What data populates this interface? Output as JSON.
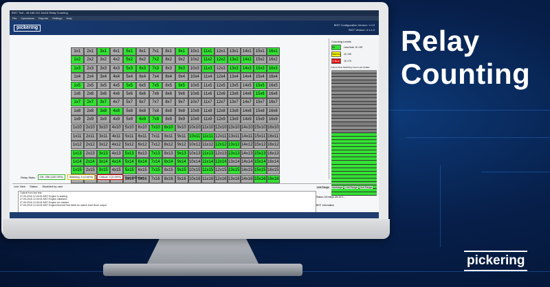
{
  "headline": "Relay Counting",
  "brand": "pickering",
  "app": {
    "title": "BIST Tool - 40-160-101 16x16 Relay Counting",
    "menu": [
      "File",
      "Operations",
      "Reports",
      "Settings",
      "Help"
    ],
    "logo": "pickering",
    "config_line1": "BIST Configuration Version: 1.0.3",
    "config_line2": "BIST Version: 4.1.4.3"
  },
  "colors": {
    "green": "#33e233",
    "gray": "#a9a9a9",
    "yellow": "#ffff00",
    "red": "#e00000"
  },
  "grid": {
    "rows": [
      [
        "1x1",
        "2x1",
        "3x1",
        "4x1",
        "5x1",
        "6x1",
        "7x1",
        "8x1",
        "9x1",
        "10x1",
        "11x1",
        "12x1",
        "13x1",
        "14x1",
        "15x1",
        "16x1"
      ],
      [
        "1x2",
        "2x2",
        "3x2",
        "4x2",
        "5x2",
        "6x2",
        "7x2",
        "8x2",
        "9x2",
        "10x2",
        "11x2",
        "12x2",
        "13x2",
        "14x2",
        "15x2",
        "16x2"
      ],
      [
        "1x3",
        "2x3",
        "3x3",
        "4x3",
        "5x3",
        "6x3",
        "7x3",
        "8x3",
        "9x3",
        "10x3",
        "11x3",
        "12x3",
        "13x3",
        "14x3",
        "15x3",
        "16x3"
      ],
      [
        "1x4",
        "2x4",
        "3x4",
        "4x4",
        "5x4",
        "6x4",
        "7x4",
        "8x4",
        "9x4",
        "10x4",
        "11x4",
        "12x4",
        "13x4",
        "14x4",
        "15x4",
        "16x4"
      ],
      [
        "1x5",
        "2x5",
        "3x5",
        "4x5",
        "5x5",
        "6x5",
        "7x5",
        "8x5",
        "9x5",
        "10x5",
        "11x5",
        "12x5",
        "13x5",
        "14x5",
        "15x5",
        "16x5"
      ],
      [
        "1x6",
        "2x6",
        "3x6",
        "4x6",
        "5x6",
        "6x6",
        "7x6",
        "8x6",
        "9x6",
        "10x6",
        "11x6",
        "12x6",
        "13x6",
        "14x6",
        "15x6",
        "16x6"
      ],
      [
        "1x7",
        "2x7",
        "3x7",
        "4x7",
        "5x7",
        "6x7",
        "7x7",
        "8x7",
        "9x7",
        "10x7",
        "11x7",
        "12x7",
        "13x7",
        "14x7",
        "15x7",
        "16x7"
      ],
      [
        "1x8",
        "2x8",
        "3x8",
        "4x8",
        "5x8",
        "6x8",
        "7x8",
        "8x8",
        "9x8",
        "10x8",
        "11x8",
        "12x8",
        "13x8",
        "14x8",
        "15x8",
        "16x8"
      ],
      [
        "1x9",
        "2x9",
        "3x9",
        "4x9",
        "5x9",
        "6x9",
        "7x9",
        "8x9",
        "9x9",
        "10x9",
        "11x9",
        "12x9",
        "13x9",
        "14x9",
        "15x9",
        "16x9"
      ],
      [
        "1x10",
        "2x10",
        "3x10",
        "4x10",
        "5x10",
        "6x10",
        "7x10",
        "8x10",
        "9x10",
        "10x10",
        "11x10",
        "12x10",
        "13x10",
        "14x10",
        "15x10",
        "16x10"
      ],
      [
        "1x11",
        "2x11",
        "3x11",
        "4x11",
        "5x11",
        "6x11",
        "7x11",
        "8x11",
        "9x11",
        "10x11",
        "11x11",
        "12x11",
        "13x11",
        "14x11",
        "15x11",
        "16x11"
      ],
      [
        "1x12",
        "2x12",
        "3x12",
        "4x12",
        "5x12",
        "6x12",
        "7x12",
        "8x12",
        "9x12",
        "10x12",
        "11x12",
        "12x12",
        "13x12",
        "14x12",
        "15x12",
        "16x12"
      ],
      [
        "1x13",
        "2x13",
        "3x13",
        "4x13",
        "5x13",
        "6x13",
        "7x13",
        "8x13",
        "9x13",
        "10x13",
        "11x13",
        "12x13",
        "13x13",
        "14x13",
        "15x13",
        "16x13"
      ],
      [
        "1x14",
        "2x14",
        "3x14",
        "4x14",
        "5x14",
        "6x14",
        "7x14",
        "8x14",
        "9x14",
        "10x14",
        "11x14",
        "12x14",
        "13x14",
        "14x14",
        "15x14",
        "16x14"
      ],
      [
        "1x15",
        "2x15",
        "3x15",
        "4x15",
        "5x15",
        "6x15",
        "7x15",
        "8x15",
        "9x15",
        "10x15",
        "11x15",
        "12x15",
        "13x15",
        "14x15",
        "15x15",
        "16x15"
      ],
      [
        "1x16",
        "2x16",
        "3x16",
        "4x16",
        "5x16",
        "6x16",
        "7x16",
        "8x16",
        "9x16",
        "10x16",
        "11x16",
        "12x16",
        "13x16",
        "14x16",
        "15x16",
        "16x16"
      ]
    ],
    "green_cells": [
      [
        2,
        0
      ],
      [
        4,
        0
      ],
      [
        8,
        0
      ],
      [
        10,
        0
      ],
      [
        15,
        0
      ],
      [
        0,
        1
      ],
      [
        4,
        1
      ],
      [
        6,
        1
      ],
      [
        10,
        1
      ],
      [
        11,
        1
      ],
      [
        12,
        1
      ],
      [
        13,
        1
      ],
      [
        0,
        2
      ],
      [
        4,
        2
      ],
      [
        5,
        2
      ],
      [
        6,
        2
      ],
      [
        8,
        2
      ],
      [
        10,
        2
      ],
      [
        12,
        2
      ],
      [
        13,
        2
      ],
      [
        14,
        2
      ],
      [
        15,
        2
      ],
      [
        0,
        4
      ],
      [
        4,
        4
      ],
      [
        6,
        4
      ],
      [
        8,
        4
      ],
      [
        14,
        4
      ],
      [
        14,
        5
      ],
      [
        0,
        6
      ],
      [
        1,
        6
      ],
      [
        2,
        6
      ],
      [
        2,
        7
      ],
      [
        3,
        7
      ],
      [
        5,
        8
      ],
      [
        6,
        8
      ],
      [
        6,
        9
      ],
      [
        7,
        9
      ],
      [
        9,
        10
      ],
      [
        10,
        10
      ],
      [
        11,
        11
      ],
      [
        12,
        11
      ],
      [
        0,
        12
      ],
      [
        2,
        12
      ],
      [
        4,
        12
      ],
      [
        6,
        12
      ],
      [
        8,
        12
      ],
      [
        10,
        12
      ],
      [
        12,
        12
      ],
      [
        14,
        12
      ],
      [
        0,
        13
      ],
      [
        1,
        13
      ],
      [
        2,
        13
      ],
      [
        3,
        13
      ],
      [
        4,
        13
      ],
      [
        5,
        13
      ],
      [
        6,
        13
      ],
      [
        7,
        13
      ],
      [
        8,
        13
      ],
      [
        10,
        13
      ],
      [
        11,
        13
      ],
      [
        14,
        13
      ],
      [
        0,
        14
      ],
      [
        2,
        14
      ],
      [
        4,
        14
      ],
      [
        6,
        14
      ],
      [
        8,
        14
      ],
      [
        10,
        14
      ],
      [
        12,
        14
      ],
      [
        14,
        14
      ],
      [
        14,
        15
      ],
      [
        15,
        15
      ]
    ]
  },
  "counting_levels": {
    "header": "Counting Levels",
    "rows": [
      {
        "swatch": "90",
        "label": "Less than 10 <99",
        "color": "#33e233"
      },
      {
        "swatch": "Warning",
        "label": "10 <99",
        "color": "#ffff00"
      },
      {
        "swatch": "Critical",
        "label": "10 >75",
        "color": "#e00000"
      }
    ],
    "table_header": "Column   Row   Switching Count   Last Update"
  },
  "relay_stats": {
    "label": "Relay Stats:",
    "ok": "OK: 256 (100.00%)",
    "warning": "Warning: 0 (0.00%)",
    "critical": "Critical: 0 (0.00%)",
    "total": "Total 256 relays"
  },
  "console": {
    "live_view": "Live View",
    "status": "Status:",
    "status_value": "Disabled by user",
    "output_label": "Output from last test:",
    "lines": [
      "27-09-2016 12:40:04 BIST Engine is starting",
      "27-09-2016 12:40:04 BIST Engine initialized",
      "27-09-2016 12:40:04 BIST Engine run started",
      "27-09-2016 12:40:04 BIST Engine/Schmitt Test Write for switch short flush output"
    ]
  },
  "right_bottom": {
    "buttons": [
      "Unit Range",
      "Discharge",
      "Unit Range",
      "Unit Range"
    ],
    "note": "Status: All relays are at 0...",
    "info_header": "BIST Information"
  }
}
